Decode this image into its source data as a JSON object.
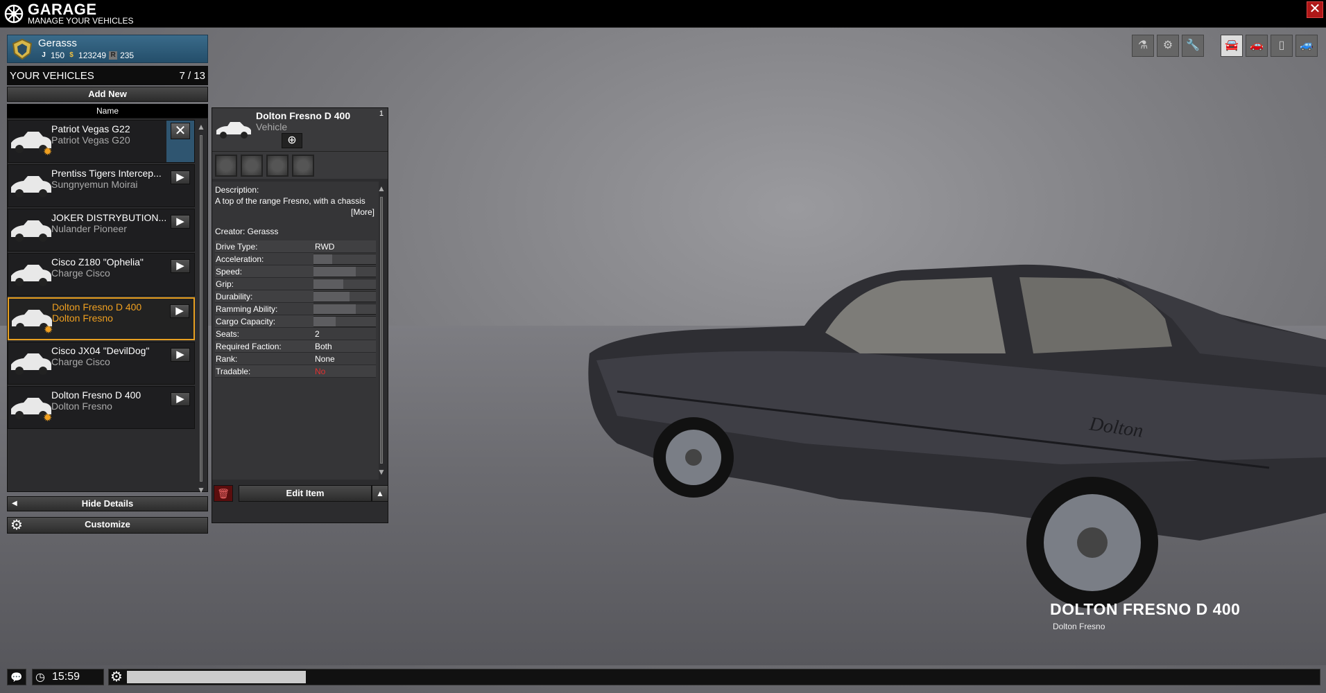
{
  "header": {
    "title": "GARAGE",
    "subtitle": "MANAGE YOUR VEHICLES",
    "close_label": "✕"
  },
  "player": {
    "name": "Gerasss",
    "level_icon": "J",
    "level": "150",
    "money_icon": "$",
    "money": "123249",
    "rank_icon": "R",
    "rank": "235"
  },
  "vehicles_panel": {
    "title": "YOUR VEHICLES",
    "count": "7 / 13",
    "add_new_label": "Add New",
    "column_header": "Name",
    "items": [
      {
        "name": "Patriot Vegas G22",
        "model": "Patriot Vegas G20",
        "has_mod": true,
        "selected": false,
        "action": "remove"
      },
      {
        "name": "Prentiss Tigers Intercep...",
        "model": "Sungnyemun Moirai",
        "has_mod": false,
        "selected": false,
        "action": "open"
      },
      {
        "name": "JOKER DISTRYBUTION...",
        "model": "Nulander Pioneer",
        "has_mod": false,
        "selected": false,
        "action": "open"
      },
      {
        "name": "Cisco Z180 \"Ophelia\"",
        "model": "Charge Cisco",
        "has_mod": false,
        "selected": false,
        "action": "open"
      },
      {
        "name": "Dolton Fresno D 400",
        "model": "Dolton Fresno",
        "has_mod": true,
        "selected": true,
        "action": "open"
      },
      {
        "name": "Cisco JX04 \"DevilDog\"",
        "model": "Charge Cisco",
        "has_mod": false,
        "selected": false,
        "action": "open"
      },
      {
        "name": "Dolton Fresno D 400",
        "model": "Dolton Fresno",
        "has_mod": true,
        "selected": false,
        "action": "open"
      }
    ],
    "hide_details_label": "Hide Details",
    "customize_label": "Customize"
  },
  "detail": {
    "name": "Dolton Fresno D 400",
    "type": "Vehicle",
    "count": "1",
    "description_label": "Description:",
    "description": "A top of the range Fresno, with a chassis",
    "more_label": "[More]",
    "creator": "Creator: Gerasss",
    "stats": [
      {
        "label": "Drive Type:",
        "text": "RWD"
      },
      {
        "label": "Acceleration:",
        "bar": 0.3
      },
      {
        "label": "Speed:",
        "bar": 0.68
      },
      {
        "label": "Grip:",
        "bar": 0.48
      },
      {
        "label": "Durability:",
        "bar": 0.58
      },
      {
        "label": "Ramming Ability:",
        "bar": 0.68
      },
      {
        "label": "Cargo Capacity:",
        "bar": 0.36
      },
      {
        "label": "Seats:",
        "text": "2"
      },
      {
        "label": "Required Faction:",
        "text": "Both"
      },
      {
        "label": "Rank:",
        "text": "None"
      },
      {
        "label": "Tradable:",
        "text": "No",
        "warn": true
      }
    ],
    "edit_label": "Edit Item"
  },
  "car_caption": {
    "title": "DOLTON FRESNO D 400",
    "subtitle": "Dolton Fresno"
  },
  "view_icons": [
    "flask-icon",
    "engine-icon",
    "wrench-icon",
    "car-side-icon",
    "car-front-icon",
    "car-top-icon",
    "car-rear-icon"
  ],
  "bottom": {
    "time": "15:59",
    "progress": 0.15
  },
  "colors": {
    "accent": "#e8a020",
    "player_bar": "#2f5a78",
    "warn": "#e23030"
  }
}
